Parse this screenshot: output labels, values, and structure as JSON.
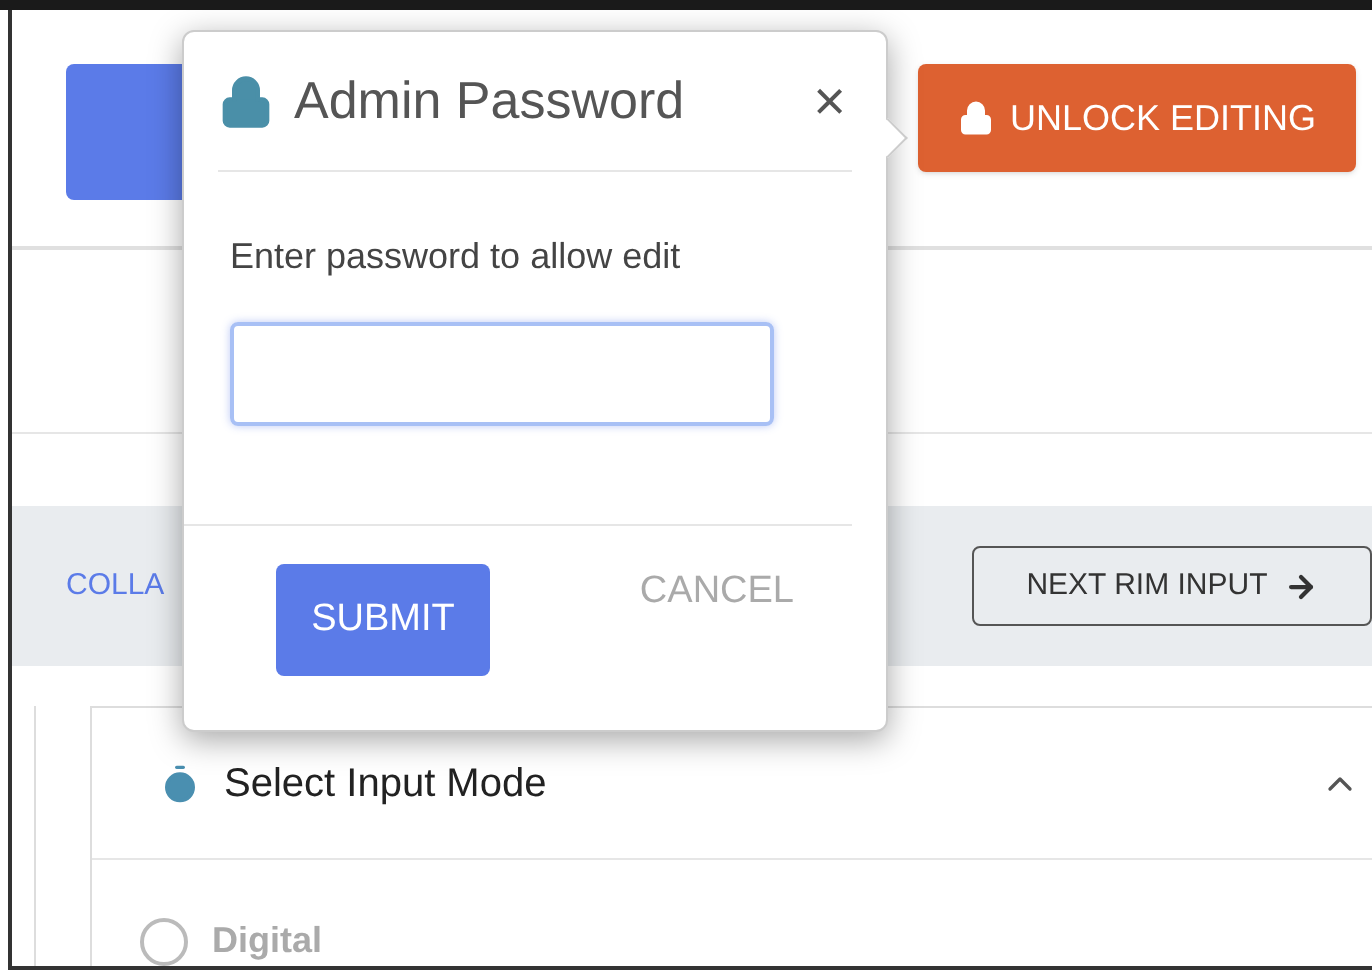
{
  "header": {
    "unlock_button": {
      "label": "UNLOCK EDITING"
    }
  },
  "toolbar": {
    "collapse_link": "COLLA",
    "next_button": {
      "label": "NEXT RIM INPUT"
    }
  },
  "section": {
    "title": "Select Input Mode",
    "expanded": true,
    "options": [
      {
        "label": "Digital",
        "selected": false
      }
    ]
  },
  "dialog": {
    "title": "Admin Password",
    "close": "×",
    "prompt": "Enter password to allow edit",
    "buttons": [
      {
        "kind": "primary",
        "label": "SUBMIT"
      },
      {
        "kind": "text",
        "label": "CANCEL"
      }
    ]
  }
}
